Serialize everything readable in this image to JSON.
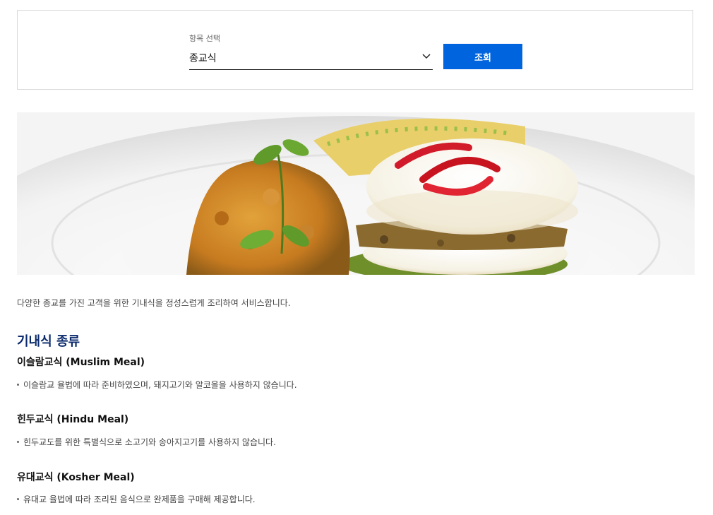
{
  "filter": {
    "label": "항목 선택",
    "selected": "종교식",
    "button": "조회"
  },
  "banner": {
    "image": "meal-photo"
  },
  "intro": "다양한 종교를 가진 고객을 위한 기내식을 정성스럽게 조리하여 서비스합니다.",
  "section_title": "기내식 종류",
  "meals": [
    {
      "name": "이슬람교식 (Muslim Meal)",
      "desc": "이슬람교 율법에 따라 준비하였으며, 돼지고기와 알코올을 사용하지 않습니다."
    },
    {
      "name": "힌두교식 (Hindu Meal)",
      "desc": "힌두교도를 위한 특별식으로 소고기와 송아지고기를 사용하지 않습니다."
    },
    {
      "name": "유대교식 (Kosher Meal)",
      "desc": "유대교 율법에 따라 조리된 음식으로 완제품을 구매해 제공합니다."
    }
  ],
  "colors": {
    "primary": "#0064de",
    "title": "#0a2a6c"
  }
}
